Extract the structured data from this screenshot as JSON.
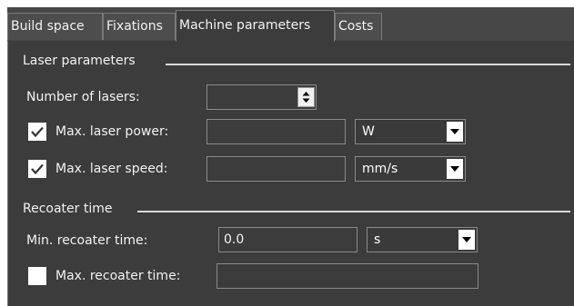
{
  "tabs": [
    {
      "label": "Build space"
    },
    {
      "label": "Fixations"
    },
    {
      "label": "Machine parameters"
    },
    {
      "label": "Costs"
    }
  ],
  "active_tab": "Machine parameters",
  "laser_group": {
    "title": "Laser parameters",
    "number_of_lasers": {
      "label": "Number of lasers:",
      "value": ""
    },
    "max_power": {
      "label": "Max. laser power:",
      "checked": true,
      "value": "",
      "unit": "W"
    },
    "max_speed": {
      "label": "Max. laser speed:",
      "checked": true,
      "value": "",
      "unit": "mm/s"
    }
  },
  "recoater_group": {
    "title": "Recoater time",
    "min_time": {
      "label": "Min. recoater time:",
      "value": "0.0",
      "unit": "s"
    },
    "max_time": {
      "label": "Max. recoater time:",
      "checked": false,
      "value": ""
    }
  },
  "colors": {
    "background": "#3c3c3c",
    "tab_bar": "#474747",
    "border": "#8a8a8a",
    "text": "#f2f2f2"
  }
}
